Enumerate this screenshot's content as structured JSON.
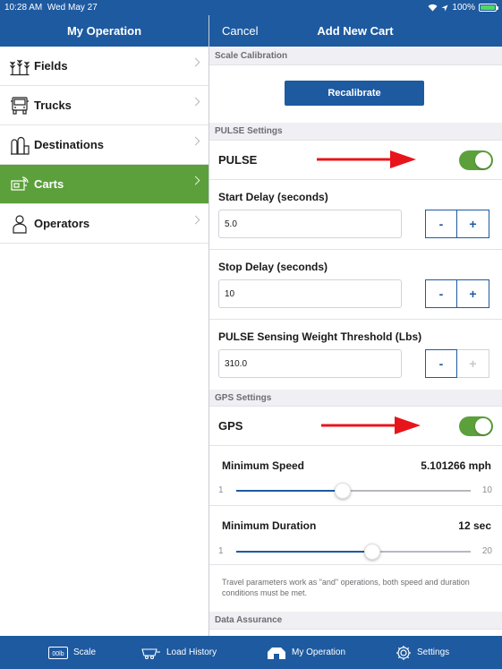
{
  "status_bar": {
    "time": "10:28 AM",
    "date": "Wed May 27",
    "battery": "100%"
  },
  "sidebar": {
    "title": "My Operation",
    "items": [
      {
        "label": "Fields",
        "icon": "plant-icon",
        "active": false
      },
      {
        "label": "Trucks",
        "icon": "truck-icon",
        "active": false
      },
      {
        "label": "Destinations",
        "icon": "silo-icon",
        "active": false
      },
      {
        "label": "Carts",
        "icon": "cart-icon",
        "active": true
      },
      {
        "label": "Operators",
        "icon": "person-icon",
        "active": false
      }
    ]
  },
  "detail": {
    "cancel_label": "Cancel",
    "title": "Add New Cart",
    "scale_calibration": {
      "header": "Scale Calibration",
      "button": "Recalibrate"
    },
    "pulse": {
      "header": "PULSE Settings",
      "toggle_label": "PULSE",
      "toggle_on": true,
      "start_delay": {
        "label": "Start Delay (seconds)",
        "value": "5.0"
      },
      "stop_delay": {
        "label": "Stop Delay (seconds)",
        "value": "10"
      },
      "threshold": {
        "label": "PULSE Sensing Weight Threshold (Lbs)",
        "value": "310.0"
      },
      "minus": "-",
      "plus": "+"
    },
    "gps": {
      "header": "GPS Settings",
      "toggle_label": "GPS",
      "toggle_on": true,
      "min_speed": {
        "label": "Minimum Speed",
        "value": "5.101266 mph",
        "min": "1",
        "max": "10",
        "level": 5.101266
      },
      "min_duration": {
        "label": "Minimum Duration",
        "value": "12 sec",
        "min": "1",
        "max": "20",
        "level": 12
      },
      "note": "Travel parameters work as \"and\" operations, both speed and duration conditions must be met."
    },
    "data_assurance": {
      "header": "Data Assurance"
    }
  },
  "tabbar": {
    "tabs": [
      {
        "label": "Scale",
        "icon": "scale-icon",
        "badge": "00lb"
      },
      {
        "label": "Load History",
        "icon": "cart-outline-icon"
      },
      {
        "label": "My Operation",
        "icon": "barn-icon",
        "active": true
      },
      {
        "label": "Settings",
        "icon": "gear-icon"
      }
    ]
  },
  "colors": {
    "brand_blue": "#1e5aa0",
    "active_green": "#5ca03c",
    "arrow_red": "#e8141b"
  }
}
